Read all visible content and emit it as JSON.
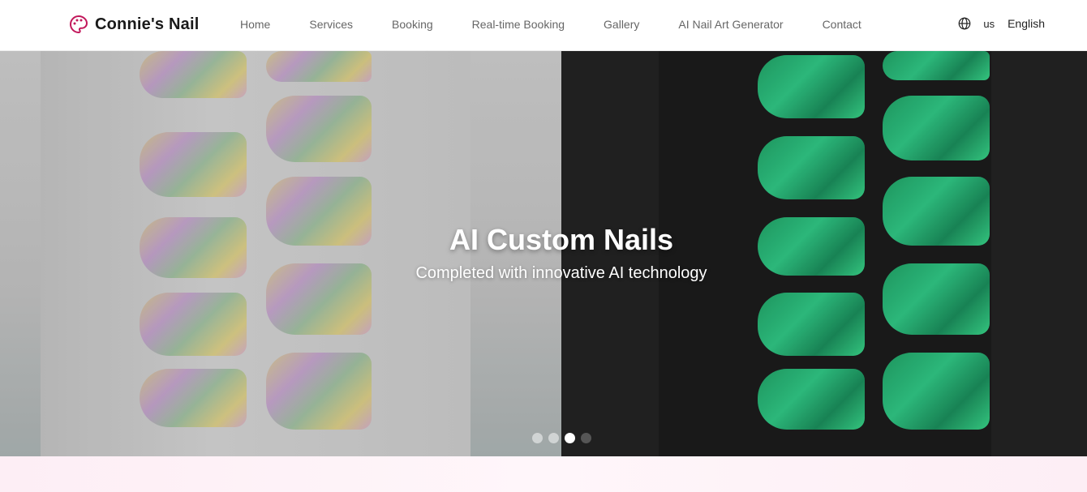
{
  "brand": {
    "name": "Connie's Nail",
    "icon": "palette-icon",
    "accent": "#c2185b"
  },
  "nav": {
    "items": [
      {
        "label": "Home"
      },
      {
        "label": "Services"
      },
      {
        "label": "Booking"
      },
      {
        "label": "Real-time Booking"
      },
      {
        "label": "Gallery"
      },
      {
        "label": "AI Nail Art Generator"
      },
      {
        "label": "Contact"
      }
    ]
  },
  "language": {
    "icon": "globe-icon",
    "code": "us",
    "name": "English"
  },
  "hero": {
    "title": "AI Custom Nails",
    "subtitle": "Completed with innovative AI technology",
    "slides_total": 4,
    "active_slide": 3
  }
}
